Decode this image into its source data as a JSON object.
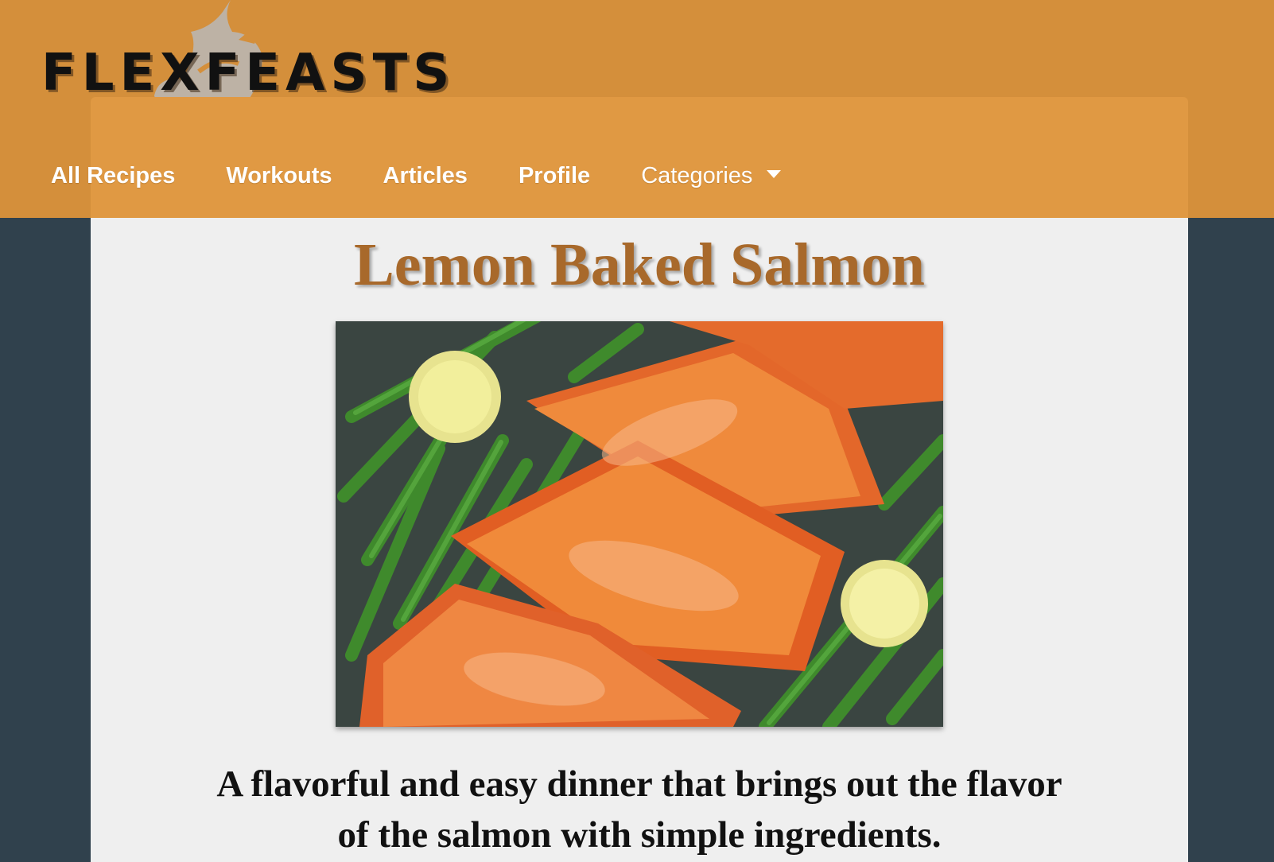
{
  "site": {
    "brand": "FLEXFEASTS",
    "logo_icon": "flexing-arm-logo",
    "colors": {
      "header": "#d48f3b",
      "nav_panel": "#e09943",
      "background": "#30414d",
      "content": "#efefef",
      "title": "#a8692b"
    }
  },
  "nav": {
    "items": [
      {
        "label": "All Recipes"
      },
      {
        "label": "Workouts"
      },
      {
        "label": "Articles"
      },
      {
        "label": "Profile"
      }
    ],
    "dropdown": {
      "label": "Categories",
      "icon": "caret-down-icon"
    }
  },
  "recipe": {
    "title": "Lemon Baked Salmon",
    "image_icon": "salmon-photo",
    "description": "A flavorful and easy dinner that brings out the flavor of the salmon with simple ingredients."
  }
}
